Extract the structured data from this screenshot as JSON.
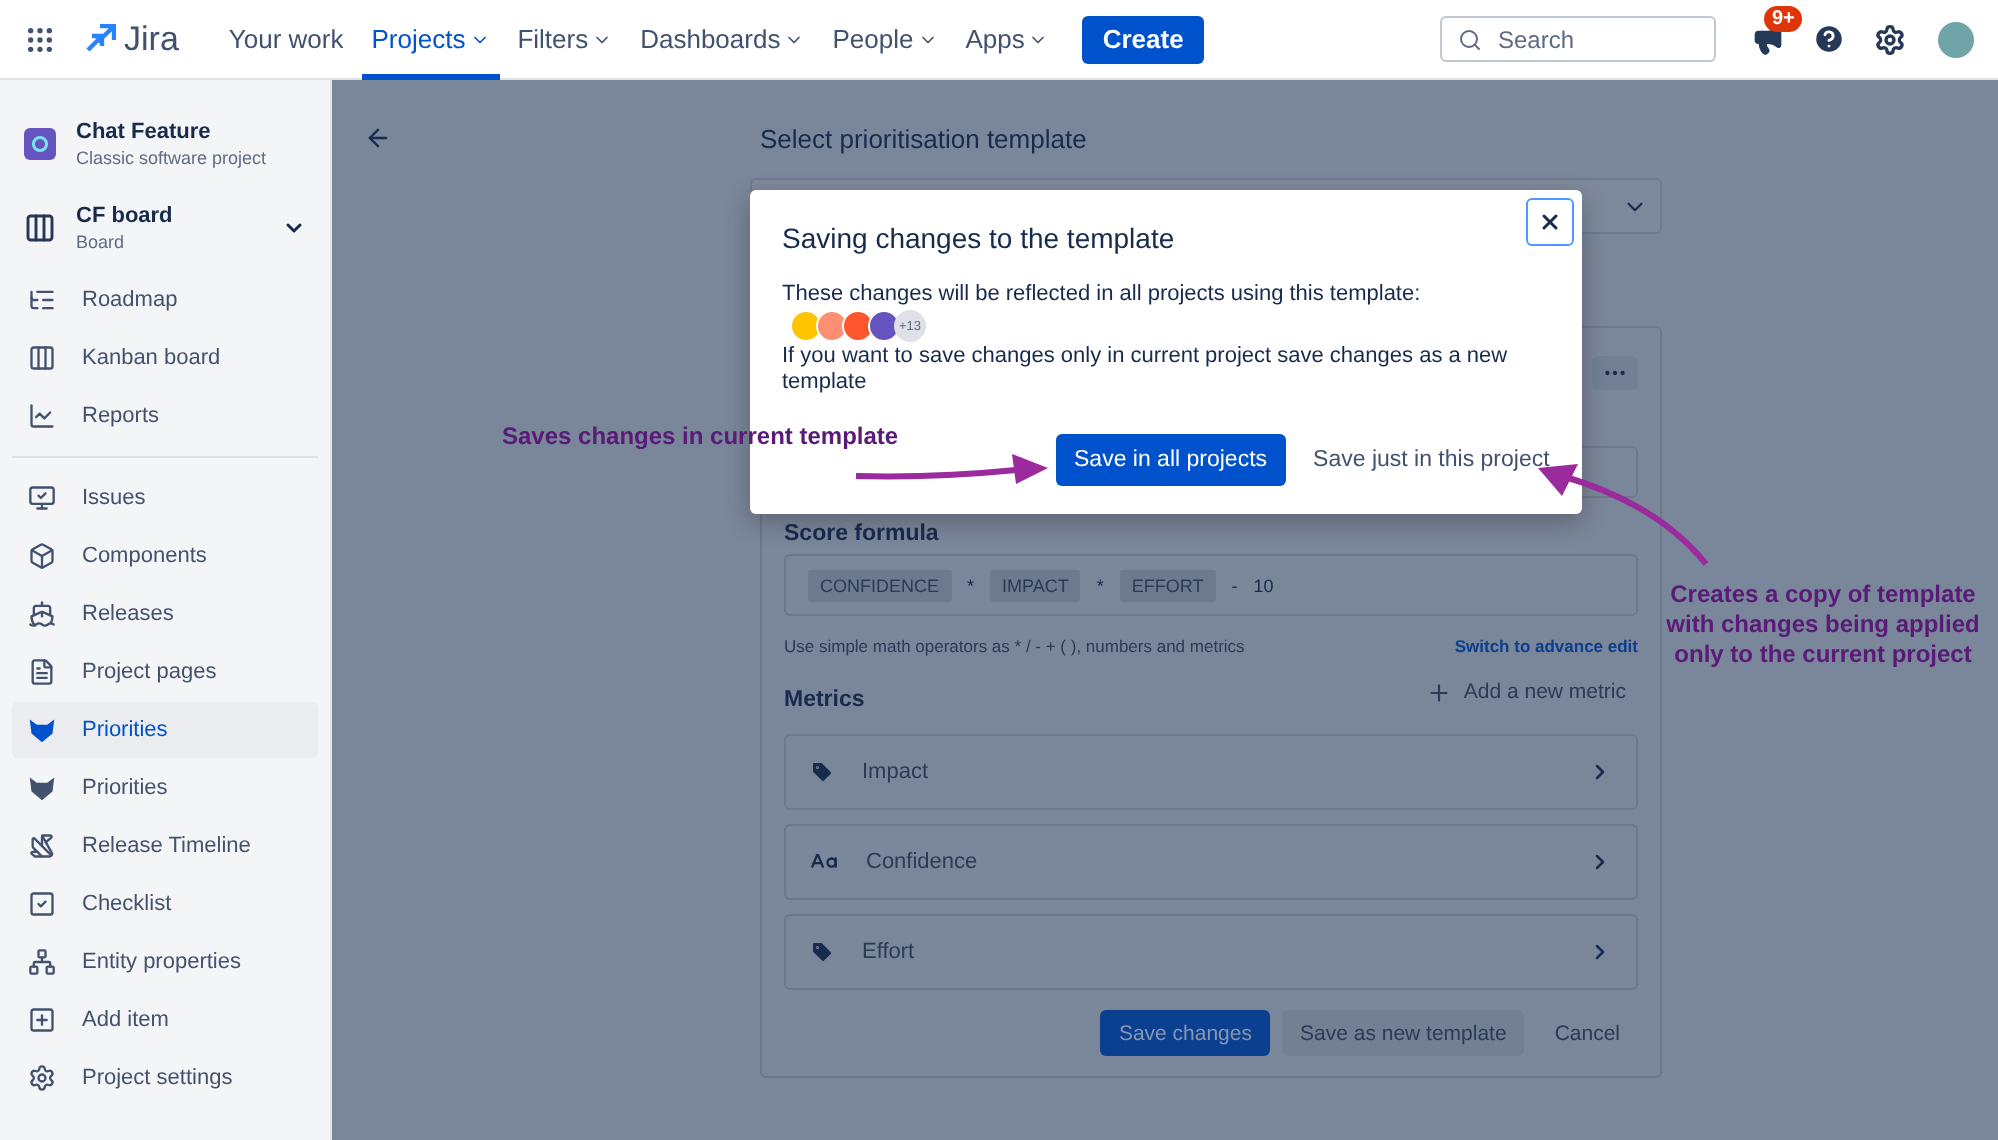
{
  "nav": {
    "app_name": "Jira",
    "items": [
      {
        "label": "Your work",
        "selected": false,
        "dropdown": false
      },
      {
        "label": "Projects",
        "selected": true,
        "dropdown": true
      },
      {
        "label": "Filters",
        "selected": false,
        "dropdown": true
      },
      {
        "label": "Dashboards",
        "selected": false,
        "dropdown": true
      },
      {
        "label": "People",
        "selected": false,
        "dropdown": true
      },
      {
        "label": "Apps",
        "selected": false,
        "dropdown": true
      }
    ],
    "create": "Create",
    "search": {
      "placeholder": "Search"
    },
    "notification_badge": "9+"
  },
  "sidebar": {
    "project": {
      "name": "Chat Feature",
      "type": "Classic software project"
    },
    "board": {
      "name": "CF board",
      "type": "Board"
    },
    "groups": [
      [
        {
          "label": "Roadmap",
          "selected": false
        },
        {
          "label": "Kanban board",
          "selected": false
        },
        {
          "label": "Reports",
          "selected": false
        }
      ],
      [
        {
          "label": "Issues",
          "selected": false
        },
        {
          "label": "Components",
          "selected": false
        },
        {
          "label": "Releases",
          "selected": false
        },
        {
          "label": "Project pages",
          "selected": false
        },
        {
          "label": "Priorities",
          "selected": true
        },
        {
          "label": "Priorities",
          "selected": false
        },
        {
          "label": "Release Timeline",
          "selected": false
        },
        {
          "label": "Checklist",
          "selected": false
        },
        {
          "label": "Entity properties",
          "selected": false
        },
        {
          "label": "Add item",
          "selected": false
        },
        {
          "label": "Project settings",
          "selected": false
        }
      ]
    ]
  },
  "page": {
    "title": "Select prioritisation template",
    "score_formula": {
      "label": "Score formula",
      "tokens": [
        {
          "kind": "chip",
          "text": "CONFIDENCE"
        },
        {
          "kind": "op",
          "text": "*"
        },
        {
          "kind": "chip",
          "text": "IMPACT"
        },
        {
          "kind": "op",
          "text": "*"
        },
        {
          "kind": "chip",
          "text": "EFFORT"
        },
        {
          "kind": "op",
          "text": "-"
        },
        {
          "kind": "op",
          "text": "10"
        }
      ],
      "hint": "Use simple math operators as * / - + ( ), numbers and metrics",
      "link": "Switch to advance edit"
    },
    "metrics": {
      "label": "Metrics",
      "add": "Add a new metric",
      "items": [
        {
          "name": "Impact",
          "kind": "label"
        },
        {
          "name": "Confidence",
          "kind": "text"
        },
        {
          "name": "Effort",
          "kind": "label"
        }
      ]
    },
    "buttons": [
      {
        "label": "Save changes",
        "kind": "primary"
      },
      {
        "label": "Save as new template",
        "kind": "secondary"
      },
      {
        "label": "Cancel",
        "kind": "subtle"
      }
    ]
  },
  "modal": {
    "title": "Saving changes to the template",
    "message": "These changes will be reflected in all projects using this template:",
    "projects_more": "+13",
    "note": "If you want to save changes only in current project save changes as a new template",
    "primary": "Save in all projects",
    "secondary": "Save just in this project"
  },
  "annotations": [
    {
      "text": "Saves changes in current template"
    },
    {
      "text": "Creates a copy of template with changes being applied only to the current project"
    }
  ]
}
